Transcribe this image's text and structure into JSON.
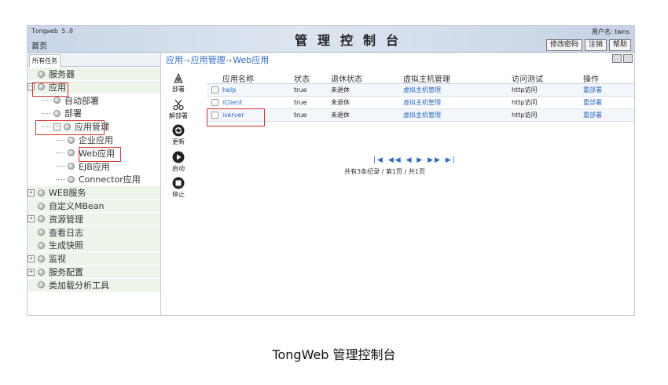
{
  "header": {
    "version": "Tongweb 5.0",
    "home": "首页",
    "title": "管理控制台",
    "user_label": "用户名: twns",
    "buttons": [
      "修改密码",
      "注销",
      "帮助"
    ]
  },
  "left": {
    "tab": "所有任务",
    "tree": [
      {
        "label": "服务器",
        "level": 0,
        "expander": ""
      },
      {
        "label": "应用",
        "level": 0,
        "expander": "−"
      },
      {
        "label": "自动部署",
        "level": 1,
        "expander": ""
      },
      {
        "label": "部署",
        "level": 1,
        "expander": ""
      },
      {
        "label": "应用管理",
        "level": 1,
        "expander": "−"
      },
      {
        "label": "企业应用",
        "level": 2,
        "expander": ""
      },
      {
        "label": "Web应用",
        "level": 2,
        "expander": ""
      },
      {
        "label": "EJB应用",
        "level": 2,
        "expander": ""
      },
      {
        "label": "Connector应用",
        "level": 2,
        "expander": ""
      },
      {
        "label": "WEB服务",
        "level": 0,
        "expander": "+"
      },
      {
        "label": "自定义MBean",
        "level": 0,
        "expander": ""
      },
      {
        "label": "资源管理",
        "level": 0,
        "expander": "+"
      },
      {
        "label": "查看日志",
        "level": 0,
        "expander": ""
      },
      {
        "label": "生成快照",
        "level": 0,
        "expander": ""
      },
      {
        "label": "监视",
        "level": 0,
        "expander": "+"
      },
      {
        "label": "服务配置",
        "level": 0,
        "expander": "+"
      },
      {
        "label": "类加载分析工具",
        "level": 0,
        "expander": ""
      }
    ]
  },
  "breadcrumb": [
    "应用",
    "应用管理",
    "Web应用"
  ],
  "tools": [
    {
      "label": "部署",
      "icon": "deploy-icon"
    },
    {
      "label": "解部署",
      "icon": "undeploy-icon"
    },
    {
      "label": "更新",
      "icon": "refresh-icon"
    },
    {
      "label": "启动",
      "icon": "play-icon"
    },
    {
      "label": "停止",
      "icon": "stop-icon"
    }
  ],
  "table": {
    "headers": [
      "应用名称",
      "状态",
      "退休状态",
      "虚拟主机管理",
      "访问测试",
      "操作"
    ],
    "rows": [
      [
        "help",
        "true",
        "未退休",
        "虚拟主机管理",
        "http访问",
        "重部署"
      ],
      [
        "iClient",
        "true",
        "未退休",
        "虚拟主机管理",
        "http访问",
        "重部署"
      ],
      [
        "iserver",
        "true",
        "未退休",
        "虚拟主机管理",
        "http访问",
        "重部署"
      ]
    ]
  },
  "pager": {
    "controls": "|◀ ◀◀ ◀ ▶ ▶▶ ▶|",
    "info": "共有3条纪录 / 第1页 / 共1页"
  },
  "caption": "TongWeb 管理控制台",
  "colors": {
    "link": "#2a6ac8",
    "highlight": "#d9322b",
    "header_bg": "#c9d6e8"
  }
}
